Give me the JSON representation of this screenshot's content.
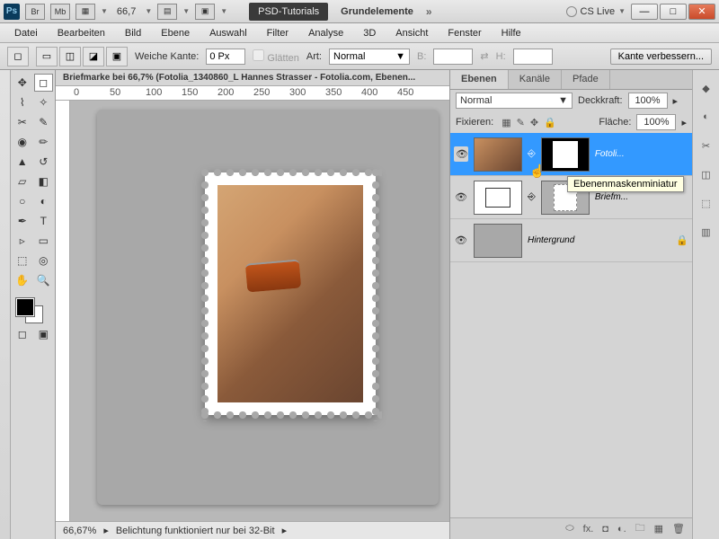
{
  "titlebar": {
    "br": "Br",
    "mb": "Mb",
    "zoom": "66,7",
    "tab_dark": "PSD-Tutorials",
    "tab_light": "Grundelemente",
    "cslive": "CS Live"
  },
  "menu": [
    "Datei",
    "Bearbeiten",
    "Bild",
    "Ebene",
    "Auswahl",
    "Filter",
    "Analyse",
    "3D",
    "Ansicht",
    "Fenster",
    "Hilfe"
  ],
  "options": {
    "weiche_kante_label": "Weiche Kante:",
    "weiche_kante_value": "0 Px",
    "glatten": "Glätten",
    "art_label": "Art:",
    "art_value": "Normal",
    "b_label": "B:",
    "h_label": "H:",
    "kante_btn": "Kante verbessern..."
  },
  "doc": {
    "tab_title": "Briefmarke bei 66,7% (Fotolia_1340860_L Hannes Strasser - Fotolia.com, Ebenen...",
    "status_zoom": "66,67%",
    "status_msg": "Belichtung funktioniert nur bei 32-Bit",
    "ruler_marks": [
      "0",
      "50",
      "100",
      "150",
      "200",
      "250",
      "300",
      "350",
      "400",
      "450"
    ]
  },
  "panel": {
    "tabs": [
      "Ebenen",
      "Kanäle",
      "Pfade"
    ],
    "blend": "Normal",
    "deckkraft_label": "Deckkraft:",
    "deckkraft_val": "100%",
    "fix_label": "Fixieren:",
    "flaeche_label": "Fläche:",
    "flaeche_val": "100%",
    "tooltip": "Ebenenmaskenminiatur",
    "layers": [
      {
        "name": "Fotoli..."
      },
      {
        "name": "Briefm..."
      },
      {
        "name": "Hintergrund"
      }
    ]
  }
}
